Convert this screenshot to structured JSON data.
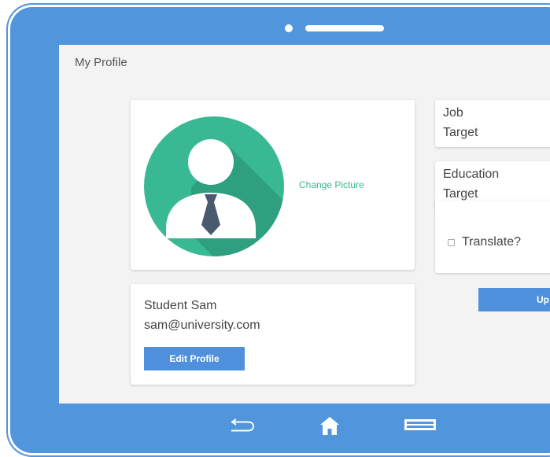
{
  "screen": {
    "title": "My Profile"
  },
  "avatar_card": {
    "change_picture_label": "Change Picture"
  },
  "profile": {
    "name": "Student Sam",
    "email": "sam@university.com",
    "edit_button_label": "Edit Profile"
  },
  "job_target": {
    "line1": "Job",
    "line2": "Target"
  },
  "education_target": {
    "line1": "Education",
    "line2": "Target"
  },
  "translate": {
    "label": "Translate?",
    "checked": false
  },
  "update_button_label": "Up",
  "nav_icons": [
    "back-icon",
    "home-icon",
    "recent-apps-icon"
  ],
  "colors": {
    "frame": "#5195dd",
    "accent_button": "#4e90dc",
    "avatar_circle": "#38b993",
    "link": "#38b993"
  }
}
